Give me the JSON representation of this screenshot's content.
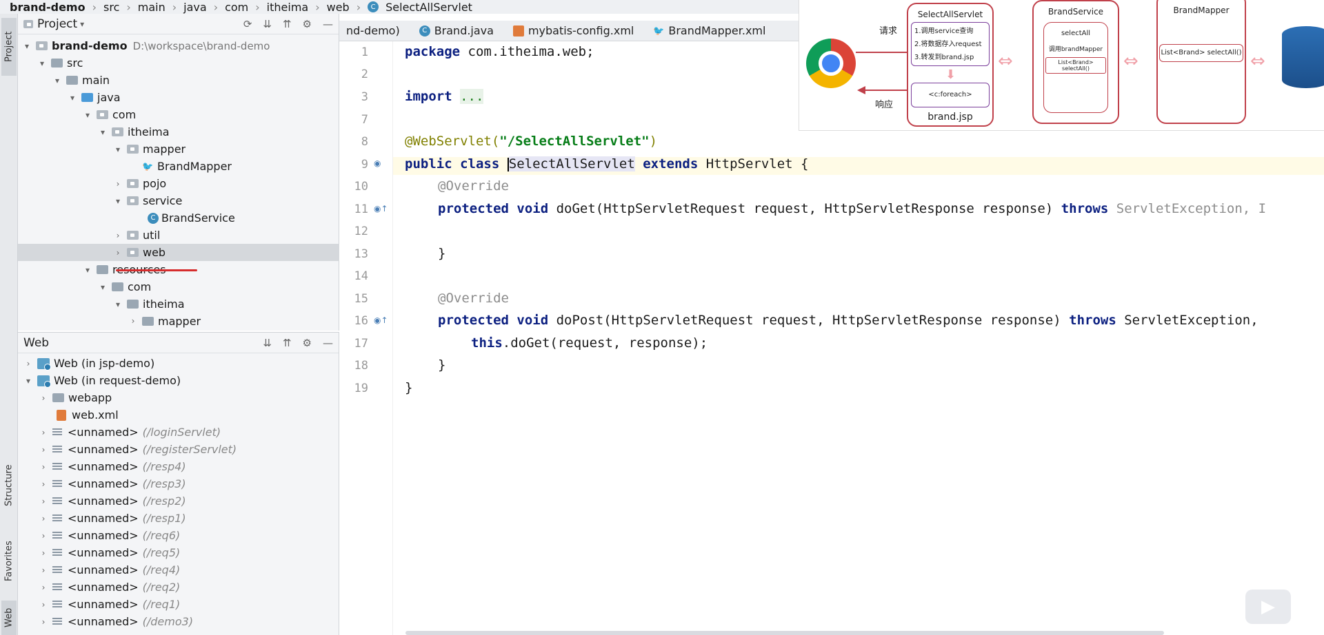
{
  "breadcrumb": [
    "brand-demo",
    "src",
    "main",
    "java",
    "com",
    "itheima",
    "web",
    "SelectAllServlet"
  ],
  "sidebar_tabs": {
    "project": "Project",
    "structure": "Structure",
    "favorites": "Favorites",
    "web": "Web"
  },
  "project_panel": {
    "title": "Project",
    "root": {
      "label": "brand-demo",
      "path": "D:\\workspace\\brand-demo"
    },
    "items": [
      {
        "label": "src"
      },
      {
        "label": "main"
      },
      {
        "label": "java"
      },
      {
        "label": "com"
      },
      {
        "label": "itheima"
      },
      {
        "label": "mapper"
      },
      {
        "label": "BrandMapper"
      },
      {
        "label": "pojo"
      },
      {
        "label": "service"
      },
      {
        "label": "BrandService"
      },
      {
        "label": "util"
      },
      {
        "label": "web"
      },
      {
        "label": "resources"
      },
      {
        "label": "com"
      },
      {
        "label": "itheima"
      },
      {
        "label": "mapper"
      }
    ]
  },
  "web_panel": {
    "title": "Web",
    "items": [
      {
        "label": "Web (in jsp-demo)"
      },
      {
        "label": "Web (in request-demo)"
      },
      {
        "label": "webapp"
      },
      {
        "label": "web.xml"
      }
    ],
    "unnamed_label": "<unnamed>",
    "unnamed_items": [
      "(/loginServlet)",
      "(/registerServlet)",
      "(/resp4)",
      "(/resp3)",
      "(/resp2)",
      "(/resp1)",
      "(/req6)",
      "(/req5)",
      "(/req4)",
      "(/req2)",
      "(/req1)",
      "(/demo3)"
    ]
  },
  "editor_tabs": [
    {
      "label": "nd-demo)"
    },
    {
      "label": "Brand.java"
    },
    {
      "label": "mybatis-config.xml"
    },
    {
      "label": "BrandMapper.xml"
    }
  ],
  "code": {
    "line_numbers": [
      "1",
      "2",
      "3",
      "7",
      "8",
      "9",
      "10",
      "11",
      "12",
      "13",
      "14",
      "15",
      "16",
      "17",
      "18",
      "19"
    ],
    "l1_kw": "package",
    "l1_rest": " com.itheima.web;",
    "l3_kw": "import",
    "l3_dots": "...",
    "l8_ann": "@WebServlet(",
    "l8_str": "\"/SelectAllServlet\"",
    "l8_end": ")",
    "l9_kw1": "public",
    "l9_kw2": "class",
    "l9_name": "SelectAllServlet",
    "l9_kw3": "extends",
    "l9_rest": " HttpServlet {",
    "override": "@Override",
    "l11_kw": "protected void",
    "l11_rest": " doGet(HttpServletRequest request, HttpServletResponse response) ",
    "l11_throws": "throws",
    "l11_exc": " ServletException, I",
    "close_brace": "}",
    "l16_kw": "protected void",
    "l16_rest": " doPost(HttpServletRequest request, HttpServletResponse response) ",
    "l16_throws": "throws",
    "l16_exc": " ServletException,",
    "l17_kw": "this",
    "l17_rest": ".doGet(request, response);",
    "l19": "}"
  },
  "diagram": {
    "request_label": "请求",
    "response_label": "响应",
    "servlet_title": "SelectAllServlet",
    "servlet_steps": [
      "1.调用service查询",
      "2.将数据存入request",
      "3.转发到brand.jsp"
    ],
    "foreach": "<c:foreach>",
    "jsp": "brand.jsp",
    "service_title": "BrandService",
    "service_method": "selectAll",
    "service_call": "调用brandMapper",
    "service_sig": "List<Brand> selectAll()",
    "mapper_title": "BrandMapper",
    "mapper_sig": "List<Brand> selectAll()"
  }
}
